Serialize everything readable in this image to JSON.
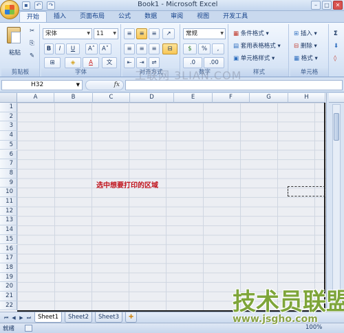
{
  "window": {
    "title": "Book1 - Microsoft Excel",
    "min_glyph": "–",
    "max_glyph": "□",
    "close_glyph": "✕"
  },
  "qat": {
    "save_glyph": "▪",
    "undo_glyph": "↶",
    "redo_glyph": "↷"
  },
  "tabs": [
    {
      "label": "开始",
      "active": true
    },
    {
      "label": "插入"
    },
    {
      "label": "页面布局"
    },
    {
      "label": "公式"
    },
    {
      "label": "数据"
    },
    {
      "label": "审阅"
    },
    {
      "label": "视图"
    },
    {
      "label": "开发工具"
    }
  ],
  "ribbon": {
    "clipboard": {
      "label": "剪贴板",
      "paste": "粘贴",
      "cut_glyph": "✂",
      "copy_glyph": "⎘",
      "format_glyph": "✎"
    },
    "font": {
      "label": "字体",
      "font_name": "宋体",
      "font_size": "11",
      "bold": "B",
      "italic": "I",
      "underline": "U",
      "grow": "A˄",
      "shrink": "A˅",
      "border_glyph": "⊞",
      "fill_glyph": "◈",
      "color_glyph": "A",
      "wen_glyph": "文"
    },
    "alignment": {
      "label": "对齐方式",
      "align_left": "≡",
      "align_center": "≡",
      "align_right": "≡",
      "wrap_glyph": "⇌",
      "merge_glyph": "⊟",
      "indent_glyph": "⇤",
      "outdent_glyph": "⇥",
      "orient_glyph": "↗"
    },
    "number": {
      "label": "数字",
      "format": "常规",
      "currency": "$",
      "percent": "%",
      "comma": ",",
      "inc_dec": ".0",
      "dec_dec": ".00"
    },
    "styles": {
      "label": "样式",
      "conditional": "条件格式",
      "table_format": "套用表格格式",
      "cell_styles": "单元格样式"
    },
    "cells": {
      "label": "单元格",
      "insert": "插入",
      "delete": "删除",
      "format": "格式"
    },
    "editing": {
      "sum_glyph": "Σ",
      "fill_glyph": "⬇",
      "clear_glyph": "◊"
    },
    "watermark": "工联网 3LIAN.COM"
  },
  "formula_bar": {
    "name_box": "H32",
    "fx": "fx",
    "value": ""
  },
  "grid": {
    "columns": [
      "A",
      "B",
      "C",
      "D",
      "E",
      "F",
      "G",
      "H"
    ],
    "rows": [
      "1",
      "2",
      "3",
      "4",
      "5",
      "6",
      "7",
      "8",
      "9",
      "10",
      "11",
      "12",
      "13",
      "14",
      "15",
      "16",
      "17",
      "18",
      "19",
      "20",
      "21",
      "22"
    ],
    "annotation": "选中想要打印的区域"
  },
  "sheets": {
    "tabs": [
      "Sheet1",
      "Sheet2",
      "Sheet3"
    ],
    "active": "Sheet1",
    "nav": [
      "⏮",
      "◀",
      "▶",
      "⏭"
    ],
    "add_glyph": "✚"
  },
  "status": {
    "text": "就绪",
    "zoom": "100%"
  },
  "brand": {
    "name": "技术员联盟",
    "url": "www.jsgho.com"
  },
  "colors": {
    "accent": "#15428b",
    "annotation": "#c0121b",
    "brand": "#7ea53a"
  }
}
